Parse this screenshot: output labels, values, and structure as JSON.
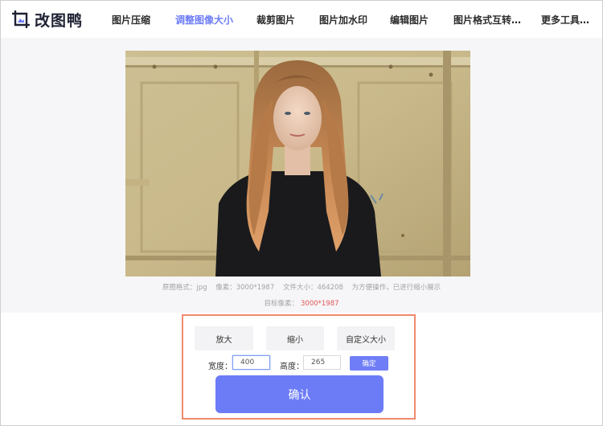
{
  "brand": {
    "name": "改图鸭",
    "accent": "#6c7cf7"
  },
  "nav": {
    "items": [
      {
        "label": "图片压缩"
      },
      {
        "label": "调整图像大小",
        "active": true
      },
      {
        "label": "裁剪图片"
      },
      {
        "label": "图片加水印"
      },
      {
        "label": "编辑图片"
      },
      {
        "label": "图片格式互转…"
      },
      {
        "label": "更多工具…"
      }
    ]
  },
  "preview": {
    "image": "photo of a young woman with long hair in a black top in front of a worn yellow metal door",
    "info": {
      "format_label": "原图格式：jpg",
      "pixels_label": "像素：3000*1987",
      "size_label": "文件大小：464208",
      "note": "为方便操作，已进行缩小展示"
    },
    "target": {
      "label": "目标像素：",
      "value": "3000*1987",
      "value_color": "#e05656"
    }
  },
  "panel": {
    "options": {
      "enlarge": "放大",
      "shrink": "缩小",
      "custom": "自定义大小"
    },
    "width": {
      "label": "宽度：",
      "value": "400"
    },
    "height": {
      "label": "高度：",
      "value": "265"
    },
    "apply_label": "确定",
    "confirm_label": "确认",
    "border_color": "#f08a6c"
  }
}
